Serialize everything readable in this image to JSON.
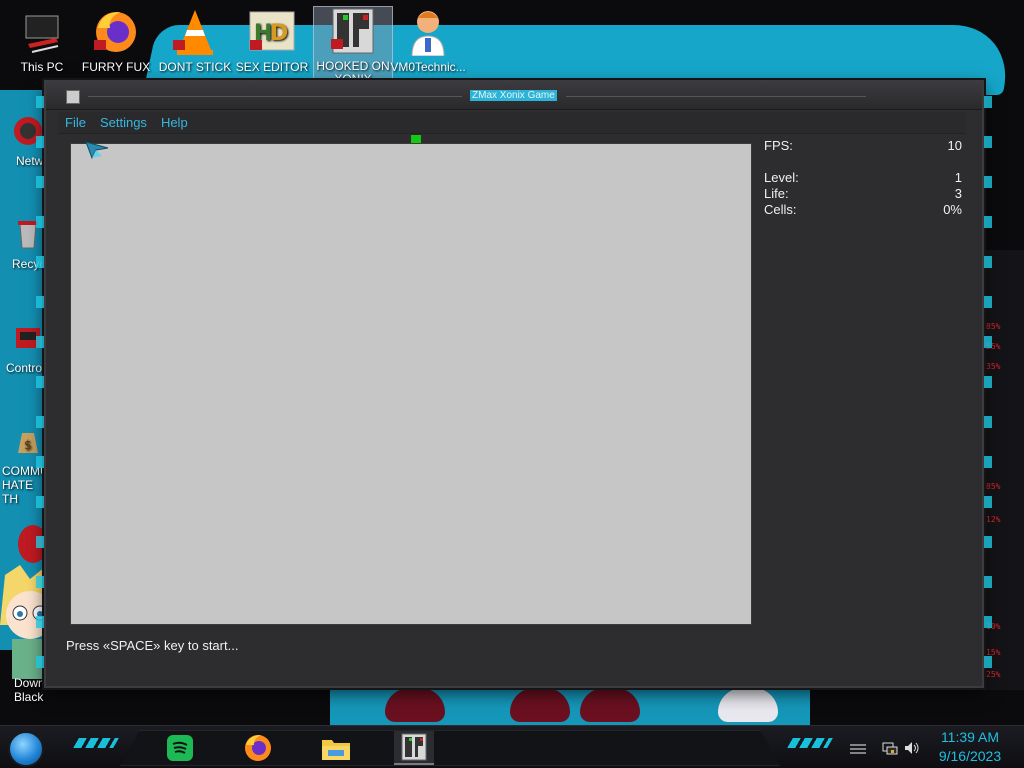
{
  "desktop": {
    "icons": [
      {
        "label": "This PC",
        "glyph": "computer-icon"
      },
      {
        "label": "FURRY FUX",
        "glyph": "firefox-icon"
      },
      {
        "label": "DONT STICK THIS IN YO...",
        "glyph": "vlc-icon"
      },
      {
        "label": "SEX EDITOR",
        "glyph": "hxd-icon"
      },
      {
        "label": "HOOKED ON XONIX",
        "glyph": "xonix-icon"
      },
      {
        "label": "VM0Technic...",
        "glyph": "doctor-icon"
      }
    ],
    "left_icons": [
      {
        "label": "Netw",
        "glyph": "network-icon"
      },
      {
        "label": "Recycl",
        "glyph": "recycle-bin-icon"
      },
      {
        "label": "Control",
        "glyph": "control-panel-icon"
      },
      {
        "label": "COMMU HATE TH",
        "glyph": "money-bag-icon"
      },
      {
        "label": "Downl Black Ali...",
        "glyph": "character-icon"
      }
    ],
    "right_readouts": [
      "85%",
      "55%",
      "35%",
      "85%",
      "12%",
      "10%",
      "15%",
      "25%"
    ]
  },
  "window": {
    "title": "ZMax Xonix Game",
    "menu": [
      "File",
      "Settings",
      "Help"
    ],
    "stats": {
      "fps_label": "FPS:",
      "fps_value": "10",
      "level_label": "Level:",
      "level_value": "1",
      "life_label": "Life:",
      "life_value": "3",
      "cells_label": "Cells:",
      "cells_value": "0%"
    },
    "status": "Press «SPACE» key to start..."
  },
  "taskbar": {
    "apps": [
      "spotify-icon",
      "firefox-icon",
      "file-explorer-icon",
      "xonix-icon"
    ],
    "clock_time": "11:39 AM",
    "clock_date": "9/16/2023"
  },
  "colors": {
    "accent": "#1ec0e0",
    "menu_text": "#35b8e0",
    "playfield": "#c6c6c6",
    "player": "#14c814"
  }
}
